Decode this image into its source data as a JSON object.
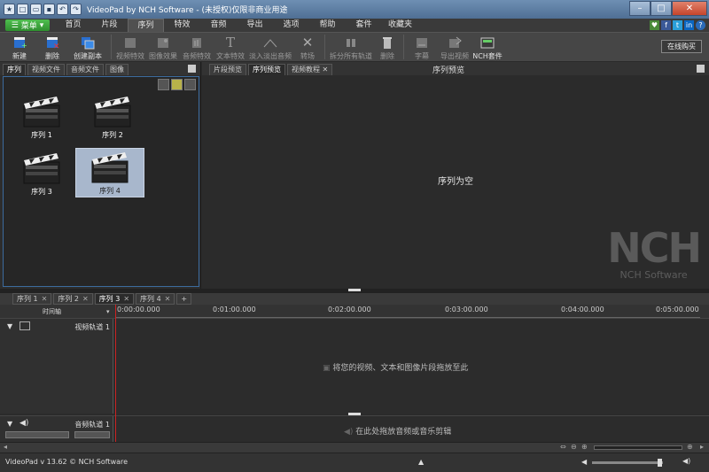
{
  "window": {
    "title": "VideoPad by NCH Software - (未授权)仅限非商业用途"
  },
  "menu": {
    "main_button": "菜单",
    "tabs": [
      "首页",
      "片段",
      "序列",
      "特效",
      "音频",
      "导出",
      "选项",
      "帮助",
      "套件",
      "收藏夹"
    ],
    "active_tab": "序列"
  },
  "toolbar": {
    "tools": [
      {
        "label": "新建",
        "icon": "new-sequence-icon",
        "enabled": true
      },
      {
        "label": "删除",
        "icon": "delete-sequence-icon",
        "enabled": true
      },
      {
        "label": "创建副本",
        "icon": "duplicate-icon",
        "enabled": true
      },
      {
        "label": "视频特效",
        "icon": "video-effects-icon",
        "enabled": false
      },
      {
        "label": "图像效果",
        "icon": "image-effects-icon",
        "enabled": false
      },
      {
        "label": "音频特效",
        "icon": "audio-effects-icon",
        "enabled": false
      },
      {
        "label": "文本特效",
        "icon": "text-effects-icon",
        "enabled": false
      },
      {
        "label": "淡入淡出音频",
        "icon": "fade-audio-icon",
        "enabled": false
      },
      {
        "label": "转场",
        "icon": "transition-icon",
        "enabled": false
      },
      {
        "label": "拆分所有轨道",
        "icon": "split-tracks-icon",
        "enabled": false
      },
      {
        "label": "删除",
        "icon": "delete-icon",
        "enabled": false
      },
      {
        "label": "字幕",
        "icon": "subtitles-icon",
        "enabled": false
      },
      {
        "label": "导出视频",
        "icon": "export-video-icon",
        "enabled": false
      },
      {
        "label": "NCH套件",
        "icon": "nch-suite-icon",
        "enabled": true
      }
    ],
    "buy_button": "在线购买"
  },
  "bin": {
    "tabs": [
      "序列",
      "视频文件",
      "音频文件",
      "图像"
    ],
    "active_tab": "序列",
    "clips": [
      {
        "label": "序列 1",
        "selected": false
      },
      {
        "label": "序列 2",
        "selected": false
      },
      {
        "label": "序列 3",
        "selected": false
      },
      {
        "label": "序列 4",
        "selected": true
      }
    ]
  },
  "preview": {
    "tabs": [
      "片段预览",
      "序列预览",
      "视频教程"
    ],
    "active_tab": "序列预览",
    "title": "序列预览",
    "empty_text": "序列为空",
    "logo_text": "NCH",
    "brand_text": "NCH Software"
  },
  "sequence_tabs": {
    "tabs": [
      "序列 1",
      "序列 2",
      "序列 3",
      "序列 4"
    ],
    "active_tab": "序列 3",
    "add_label": "+"
  },
  "timeline": {
    "label": "时间轴",
    "ticks": [
      "0:00:00.000",
      "0:01:00.000",
      "0:02:00.000",
      "0:03:00.000",
      "0:04:00.000",
      "0:05:00.000"
    ],
    "video_track": {
      "name": "视频轨道 1",
      "hint": "将您的视频、文本和图像片段拖放至此"
    },
    "audio_track": {
      "name": "音频轨道 1",
      "hint": "在此处拖放音频或音乐剪辑"
    }
  },
  "status": {
    "text": "VideoPad v 13.62 © NCH Software"
  }
}
